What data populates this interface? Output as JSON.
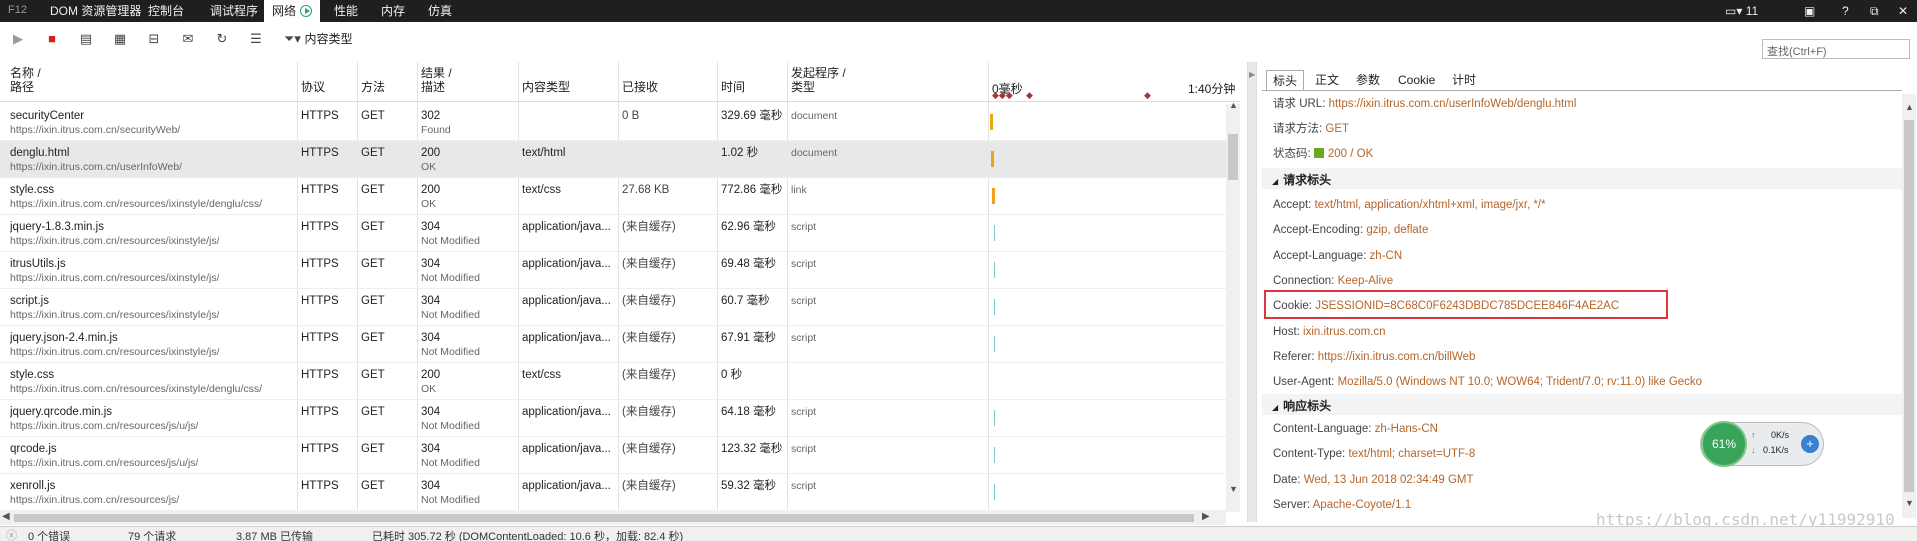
{
  "topbar": {
    "f12": "F12",
    "tabs": [
      "DOM 资源管理器",
      "控制台",
      "调试程序",
      "网络",
      "性能",
      "内存",
      "仿真"
    ],
    "device_count": "11",
    "help": "?"
  },
  "toolbar": {
    "content_type_label": "内容类型",
    "find_placeholder": "查找(Ctrl+F)"
  },
  "columns": {
    "name": [
      "名称 /",
      "路径"
    ],
    "protocol": "协议",
    "method": "方法",
    "result": [
      "结果 /",
      "描述"
    ],
    "content_type": "内容类型",
    "received": "已接收",
    "time": "时间",
    "initiator": [
      "发起程序 /",
      "类型"
    ],
    "timeline_start": "0毫秒",
    "timeline_end": "1:40分钟"
  },
  "rows": [
    {
      "name": "securityCenter",
      "path": "https://ixin.itrus.com.cn/securityWeb/",
      "protocol": "HTTPS",
      "method": "GET",
      "status": "302",
      "desc": "Found",
      "ctype": "",
      "received": "0 B",
      "time": "329.69 毫秒",
      "initiator": "document",
      "bar": "#f0a020"
    },
    {
      "name": "denglu.html",
      "path": "https://ixin.itrus.com.cn/userInfoWeb/",
      "protocol": "HTTPS",
      "method": "GET",
      "status": "200",
      "desc": "OK",
      "ctype": "text/html",
      "received": "",
      "time": "1.02 秒",
      "initiator": "document",
      "bar": "#f0a020"
    },
    {
      "name": "style.css",
      "path": "https://ixin.itrus.com.cn/resources/ixinstyle/denglu/css/",
      "protocol": "HTTPS",
      "method": "GET",
      "status": "200",
      "desc": "OK",
      "ctype": "text/css",
      "received": "27.68 KB",
      "time": "772.86 毫秒",
      "initiator": "link",
      "bar": "#f0a020"
    },
    {
      "name": "jquery-1.8.3.min.js",
      "path": "https://ixin.itrus.com.cn/resources/ixinstyle/js/",
      "protocol": "HTTPS",
      "method": "GET",
      "status": "304",
      "desc": "Not Modified",
      "ctype": "application/java...",
      "received": "(来自缓存)",
      "time": "62.96 毫秒",
      "initiator": "script",
      "bar": "#7fc8c8"
    },
    {
      "name": "itrusUtils.js",
      "path": "https://ixin.itrus.com.cn/resources/ixinstyle/js/",
      "protocol": "HTTPS",
      "method": "GET",
      "status": "304",
      "desc": "Not Modified",
      "ctype": "application/java...",
      "received": "(来自缓存)",
      "time": "69.48 毫秒",
      "initiator": "script",
      "bar": "#7fc8c8"
    },
    {
      "name": "script.js",
      "path": "https://ixin.itrus.com.cn/resources/ixinstyle/js/",
      "protocol": "HTTPS",
      "method": "GET",
      "status": "304",
      "desc": "Not Modified",
      "ctype": "application/java...",
      "received": "(来自缓存)",
      "time": "60.7 毫秒",
      "initiator": "script",
      "bar": "#7fc8c8"
    },
    {
      "name": "jquery.json-2.4.min.js",
      "path": "https://ixin.itrus.com.cn/resources/ixinstyle/js/",
      "protocol": "HTTPS",
      "method": "GET",
      "status": "304",
      "desc": "Not Modified",
      "ctype": "application/java...",
      "received": "(来自缓存)",
      "time": "67.91 毫秒",
      "initiator": "script",
      "bar": "#7fc8c8"
    },
    {
      "name": "style.css",
      "path": "https://ixin.itrus.com.cn/resources/ixinstyle/denglu/css/",
      "protocol": "HTTPS",
      "method": "GET",
      "status": "200",
      "desc": "OK",
      "ctype": "text/css",
      "received": "(来自缓存)",
      "time": "0 秒",
      "initiator": "",
      "bar": ""
    },
    {
      "name": "jquery.qrcode.min.js",
      "path": "https://ixin.itrus.com.cn/resources/js/u/js/",
      "protocol": "HTTPS",
      "method": "GET",
      "status": "304",
      "desc": "Not Modified",
      "ctype": "application/java...",
      "received": "(来自缓存)",
      "time": "64.18 毫秒",
      "initiator": "script",
      "bar": "#7fc8c8"
    },
    {
      "name": "qrcode.js",
      "path": "https://ixin.itrus.com.cn/resources/js/u/js/",
      "protocol": "HTTPS",
      "method": "GET",
      "status": "304",
      "desc": "Not Modified",
      "ctype": "application/java...",
      "received": "(来自缓存)",
      "time": "123.32 毫秒",
      "initiator": "script",
      "bar": "#7fc8c8"
    },
    {
      "name": "xenroll.js",
      "path": "https://ixin.itrus.com.cn/resources/js/",
      "protocol": "HTTPS",
      "method": "GET",
      "status": "304",
      "desc": "Not Modified",
      "ctype": "application/java...",
      "received": "(来自缓存)",
      "time": "59.32 毫秒",
      "initiator": "script",
      "bar": "#7fc8c8"
    }
  ],
  "details": {
    "tabs": [
      "标头",
      "正文",
      "参数",
      "Cookie",
      "计时"
    ],
    "general": [
      {
        "k": "请求 URL: ",
        "v": "https://ixin.itrus.com.cn/userInfoWeb/denglu.html"
      },
      {
        "k": "请求方法: ",
        "v": "GET"
      },
      {
        "k": "状态码: ",
        "v": "200 / OK"
      }
    ],
    "request_headers_title": "请求标头",
    "request_headers": [
      {
        "k": "Accept: ",
        "v": "text/html, application/xhtml+xml, image/jxr, */*"
      },
      {
        "k": "Accept-Encoding: ",
        "v": "gzip, deflate"
      },
      {
        "k": "Accept-Language: ",
        "v": "zh-CN"
      },
      {
        "k": "Connection: ",
        "v": "Keep-Alive"
      },
      {
        "k": "Cookie: ",
        "v": "JSESSIONID=8C68C0F6243DBDC785DCEE846F4AE2AC"
      },
      {
        "k": "Host: ",
        "v": "ixin.itrus.com.cn"
      },
      {
        "k": "Referer: ",
        "v": "https://ixin.itrus.com.cn/billWeb"
      },
      {
        "k": "User-Agent: ",
        "v": "Mozilla/5.0 (Windows NT 10.0; WOW64; Trident/7.0; rv:11.0) like Gecko"
      }
    ],
    "response_headers_title": "响应标头",
    "response_headers": [
      {
        "k": "Content-Language: ",
        "v": "zh-Hans-CN"
      },
      {
        "k": "Content-Type: ",
        "v": "text/html; charset=UTF-8"
      },
      {
        "k": "Date: ",
        "v": "Wed, 13 Jun 2018 02:34:49 GMT"
      },
      {
        "k": "Server: ",
        "v": "Apache-Coyote/1.1"
      }
    ],
    "highlight_color": "#d9363e",
    "status_color": "#6aa820"
  },
  "speed_widget": {
    "percent": "61%",
    "up": "0K/s",
    "down": "0.1K/s"
  },
  "watermark": "https://blog.csdn.net/y11992910",
  "statusbar": {
    "errors": "0 个错误",
    "requests": "79 个请求",
    "transferred": "3.87 MB 已传输",
    "elapsed": "已耗时 305.72 秒 (DOMContentLoaded: 10.6 秒，加载: 82.4 秒)"
  }
}
